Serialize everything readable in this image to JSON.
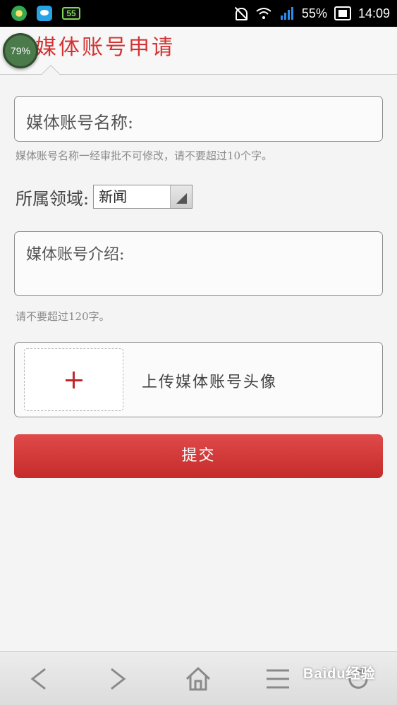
{
  "status_bar": {
    "battery_percent": "55%",
    "time": "14:09",
    "app_badge": "55"
  },
  "floating_badge": "79%",
  "header": {
    "title": "媒体账号申请"
  },
  "form": {
    "name_field_placeholder": "媒体账号名称:",
    "name_hint": "媒体账号名称一经审批不可修改，请不要超过10个字。",
    "domain_label": "所属领域:",
    "domain_selected": "新闻",
    "intro_field_placeholder": "媒体账号介绍:",
    "intro_hint": "请不要超过120字。",
    "upload_label": "上传媒体账号头像",
    "submit_label": "提交"
  },
  "bottom_nav": {
    "items": [
      "back-icon",
      "forward-icon",
      "home-icon",
      "menu-icon",
      "refresh-icon"
    ]
  },
  "watermark": "Baidu经验",
  "colors": {
    "accent": "#d23333",
    "button": "#cf3434"
  }
}
